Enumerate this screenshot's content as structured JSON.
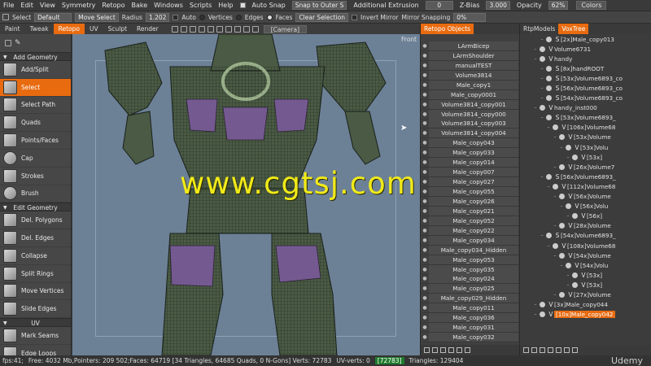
{
  "menu": {
    "items": [
      "File",
      "Edit",
      "View",
      "Symmetry",
      "Retopo",
      "Bake",
      "Windows",
      "Scripts",
      "Help"
    ],
    "snap_label": "Auto Snap",
    "snap_mode": "Snap to Outer S",
    "extrusion_label": "Additional Extrusion",
    "extrusion_value": "0",
    "zbias_label": "Z-Bias",
    "zbias_value": "3.000",
    "opacity_label": "Opacity",
    "opacity_value": "62%",
    "colors_label": "Colors"
  },
  "toolbar": {
    "select_label": "Select",
    "preset": "Default",
    "move_select": "Move Select",
    "radius_label": "Radius",
    "radius_value": "1.202",
    "auto_label": "Auto",
    "vertices_label": "Vertices",
    "edges_label": "Edges",
    "faces_label": "Faces",
    "clear_selection": "Clear Selection",
    "invert_mirror": "Invert Mirror",
    "mirror_snapping": "Mirror Snapping",
    "mirror_value": "0%"
  },
  "room_tabs": [
    "Paint",
    "Tweak",
    "Retopo",
    "UV",
    "Sculpt",
    "Render"
  ],
  "active_room": "Retopo",
  "camera": "[Camera]",
  "viewport": {
    "label": "Front",
    "watermark": "www.cgtsj.com"
  },
  "left_panel": {
    "sections": {
      "add_geometry": "Add Geometry",
      "edit_geometry": "Edit Geometry",
      "uv": "UV"
    },
    "add_tools": [
      "Add/Split",
      "Select",
      "Select Path",
      "Quads",
      "Points/Faces",
      "Cap",
      "Strokes",
      "Brush"
    ],
    "edit_tools": [
      "Del. Polygons",
      "Del. Edges",
      "Collapse",
      "Split Rings",
      "Move Vertices",
      "Slide Edges"
    ],
    "uv_tools": [
      "Mark Seams",
      "Edge Loops"
    ],
    "active_tool": "Select"
  },
  "retopo_panel": {
    "tab": "Retopo Objects",
    "objects": [
      "LArmBicep",
      "LArmShoulder",
      "manualTEST",
      "Volume3814",
      "Male_copy1",
      "Male_copy0001",
      "Volume3814_copy001",
      "Volume3814_copy000",
      "Volume3814_copy003",
      "Volume3814_copy004",
      "Male_copy043",
      "Male_copy033",
      "Male_copy014",
      "Male_copy007",
      "Male_copy027",
      "Male_copy055",
      "Male_copy026",
      "Male_copy021",
      "Male_copy052",
      "Male_copy022",
      "Male_copy034",
      "Male_copy034_Hidden",
      "Male_copy053",
      "Male_copy035",
      "Male_copy024",
      "Male_copy025",
      "Male_copy029_Hidden",
      "Male_copy011",
      "Male_copy036",
      "Male_copy031",
      "Male_copy032"
    ]
  },
  "voxtree_panel": {
    "tabs": [
      "RtpModels",
      "VoxTree"
    ],
    "active_tab": "VoxTree",
    "rows": [
      {
        "text": "[2x]Male_copy013",
        "indent": 1,
        "mark": "S"
      },
      {
        "text": "Volume6731",
        "indent": 0,
        "mark": "V"
      },
      {
        "text": "handy",
        "indent": 0,
        "mark": "V"
      },
      {
        "text": "[8x]handROOT",
        "indent": 1,
        "mark": "S"
      },
      {
        "text": "[53x]Volume6893_co",
        "indent": 1,
        "mark": "S"
      },
      {
        "text": "[56x]Volume6893_co",
        "indent": 1,
        "mark": "S"
      },
      {
        "text": "[54x]Volume6893_co",
        "indent": 1,
        "mark": "S"
      },
      {
        "text": "handy_inst000",
        "indent": 0,
        "mark": "V"
      },
      {
        "text": "[53x]Volume6893_",
        "indent": 1,
        "mark": "S"
      },
      {
        "text": "[106x]Volume68",
        "indent": 2,
        "mark": "V"
      },
      {
        "text": "[53x]Volume",
        "indent": 3,
        "mark": "V"
      },
      {
        "text": "[53x]Volu",
        "indent": 4,
        "mark": "V"
      },
      {
        "text": "[53x]",
        "indent": 5,
        "mark": "V"
      },
      {
        "text": "[26x]Volume7",
        "indent": 3,
        "mark": "V"
      },
      {
        "text": "[56x]Volume6893_",
        "indent": 1,
        "mark": "S"
      },
      {
        "text": "[112x]Volume68",
        "indent": 2,
        "mark": "V"
      },
      {
        "text": "[56x]Volume",
        "indent": 3,
        "mark": "V"
      },
      {
        "text": "[56x]Volu",
        "indent": 4,
        "mark": "V"
      },
      {
        "text": "[56x]",
        "indent": 5,
        "mark": "V"
      },
      {
        "text": "[28x]Volume",
        "indent": 3,
        "mark": "V"
      },
      {
        "text": "[54x]Volume6893_",
        "indent": 1,
        "mark": "S"
      },
      {
        "text": "[108x]Volume68",
        "indent": 2,
        "mark": "V"
      },
      {
        "text": "[54x]Volume",
        "indent": 3,
        "mark": "V"
      },
      {
        "text": "[54x]Volu",
        "indent": 4,
        "mark": "V"
      },
      {
        "text": "[53x]",
        "indent": 5,
        "mark": "V"
      },
      {
        "text": "[53x]",
        "indent": 5,
        "mark": "V"
      },
      {
        "text": "[27x]Volume",
        "indent": 3,
        "mark": "V"
      },
      {
        "text": "[3x]Male_copy044",
        "indent": 0,
        "mark": "V"
      },
      {
        "text": "[10x]Male_copy042",
        "indent": 0,
        "mark": "V",
        "selected": true
      }
    ]
  },
  "status": {
    "fps": "fps:41;",
    "memory": "Free: 4032 Mb,Pointers: 209 502;Faces: 64719 [34 Triangles, 64685 Quads, 0 N-Gons] Verts: 72783",
    "uv_verts_label": "UV-verts: 0",
    "uv_verts_value": "[72783]",
    "triangles": "Triangles: 129404",
    "brand": "Udemy"
  },
  "colors": {
    "accent": "#e86b10",
    "viewport_bg": "#6c8196",
    "watermark": "#f1ea1a"
  }
}
